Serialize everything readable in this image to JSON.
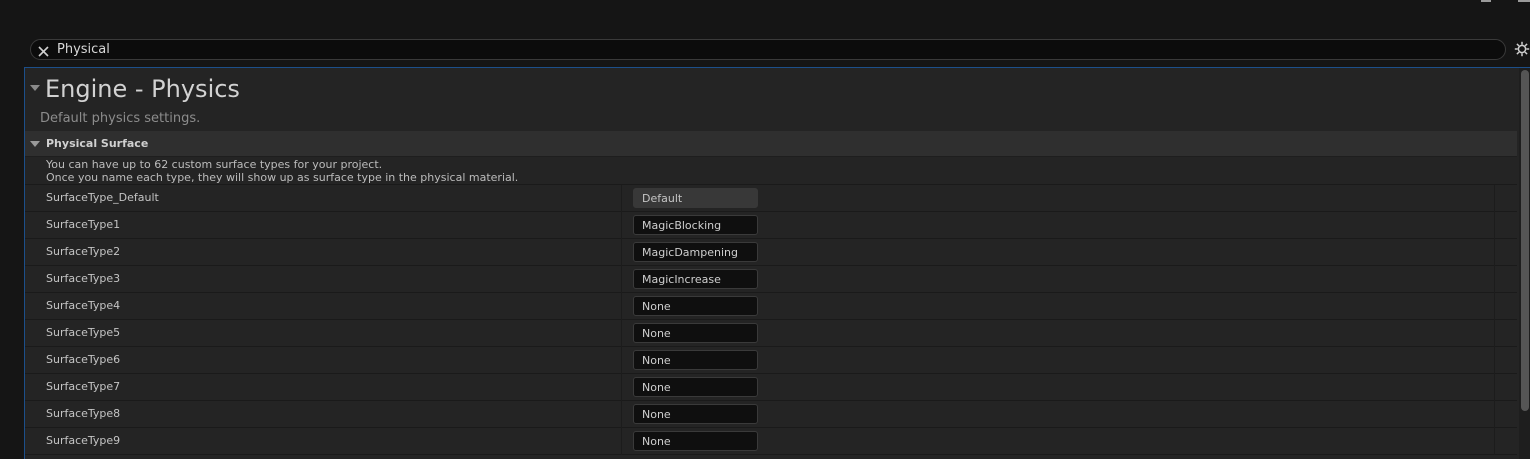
{
  "search": {
    "value": "Physical",
    "clear_icon": "close-icon",
    "settings_icon": "gear-icon"
  },
  "section": {
    "title": "Engine - Physics",
    "description": "Default physics settings."
  },
  "category": {
    "title": "Physical Surface",
    "note_line1": "You can have up to 62 custom surface types for your project.",
    "note_line2": "Once you name each type, they will show up as surface type in the physical material."
  },
  "rows": [
    {
      "label": "SurfaceType_Default",
      "value": "Default",
      "readonly": true
    },
    {
      "label": "SurfaceType1",
      "value": "MagicBlocking",
      "readonly": false
    },
    {
      "label": "SurfaceType2",
      "value": "MagicDampening",
      "readonly": false
    },
    {
      "label": "SurfaceType3",
      "value": "MagicIncrease",
      "readonly": false
    },
    {
      "label": "SurfaceType4",
      "value": "None",
      "readonly": false
    },
    {
      "label": "SurfaceType5",
      "value": "None",
      "readonly": false
    },
    {
      "label": "SurfaceType6",
      "value": "None",
      "readonly": false
    },
    {
      "label": "SurfaceType7",
      "value": "None",
      "readonly": false
    },
    {
      "label": "SurfaceType8",
      "value": "None",
      "readonly": false
    },
    {
      "label": "SurfaceType9",
      "value": "None",
      "readonly": false
    }
  ],
  "colors": {
    "panel_accent": "#1c4f8a",
    "background": "#242424",
    "category_header": "#2f2f2f"
  }
}
